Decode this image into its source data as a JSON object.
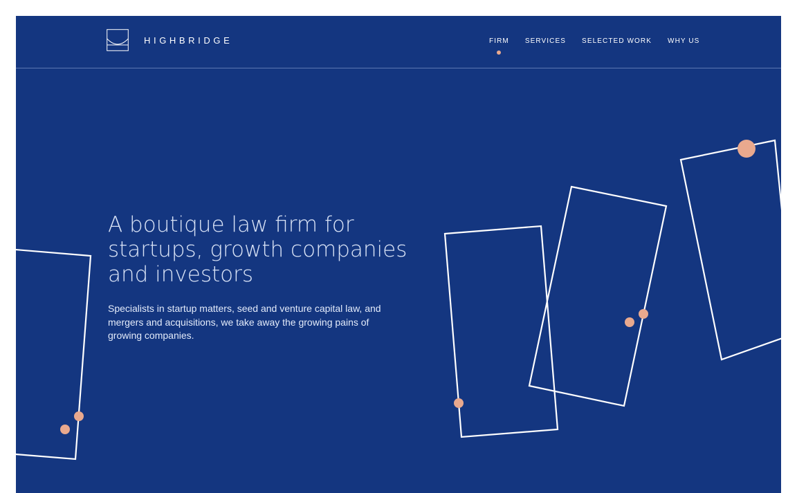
{
  "brand": {
    "name": "HIGHBRIDGE",
    "logo_icon": "bridge-arch-logo-icon"
  },
  "nav": {
    "items": [
      {
        "label": "FIRM",
        "active": true
      },
      {
        "label": "SERVICES",
        "active": false
      },
      {
        "label": "SELECTED WORK",
        "active": false
      },
      {
        "label": "WHY US",
        "active": false
      }
    ]
  },
  "hero": {
    "title": "A boutique law firm for startups, growth companies and investors",
    "subtitle": "Specialists in startup matters, seed and venture capital law, and mergers and acquisitions, we take away the growing pains of growing companies."
  },
  "colors": {
    "background": "#143680",
    "accent": "#E9A98E",
    "line": "#FFFFFF",
    "text": "#D9E3F6"
  }
}
